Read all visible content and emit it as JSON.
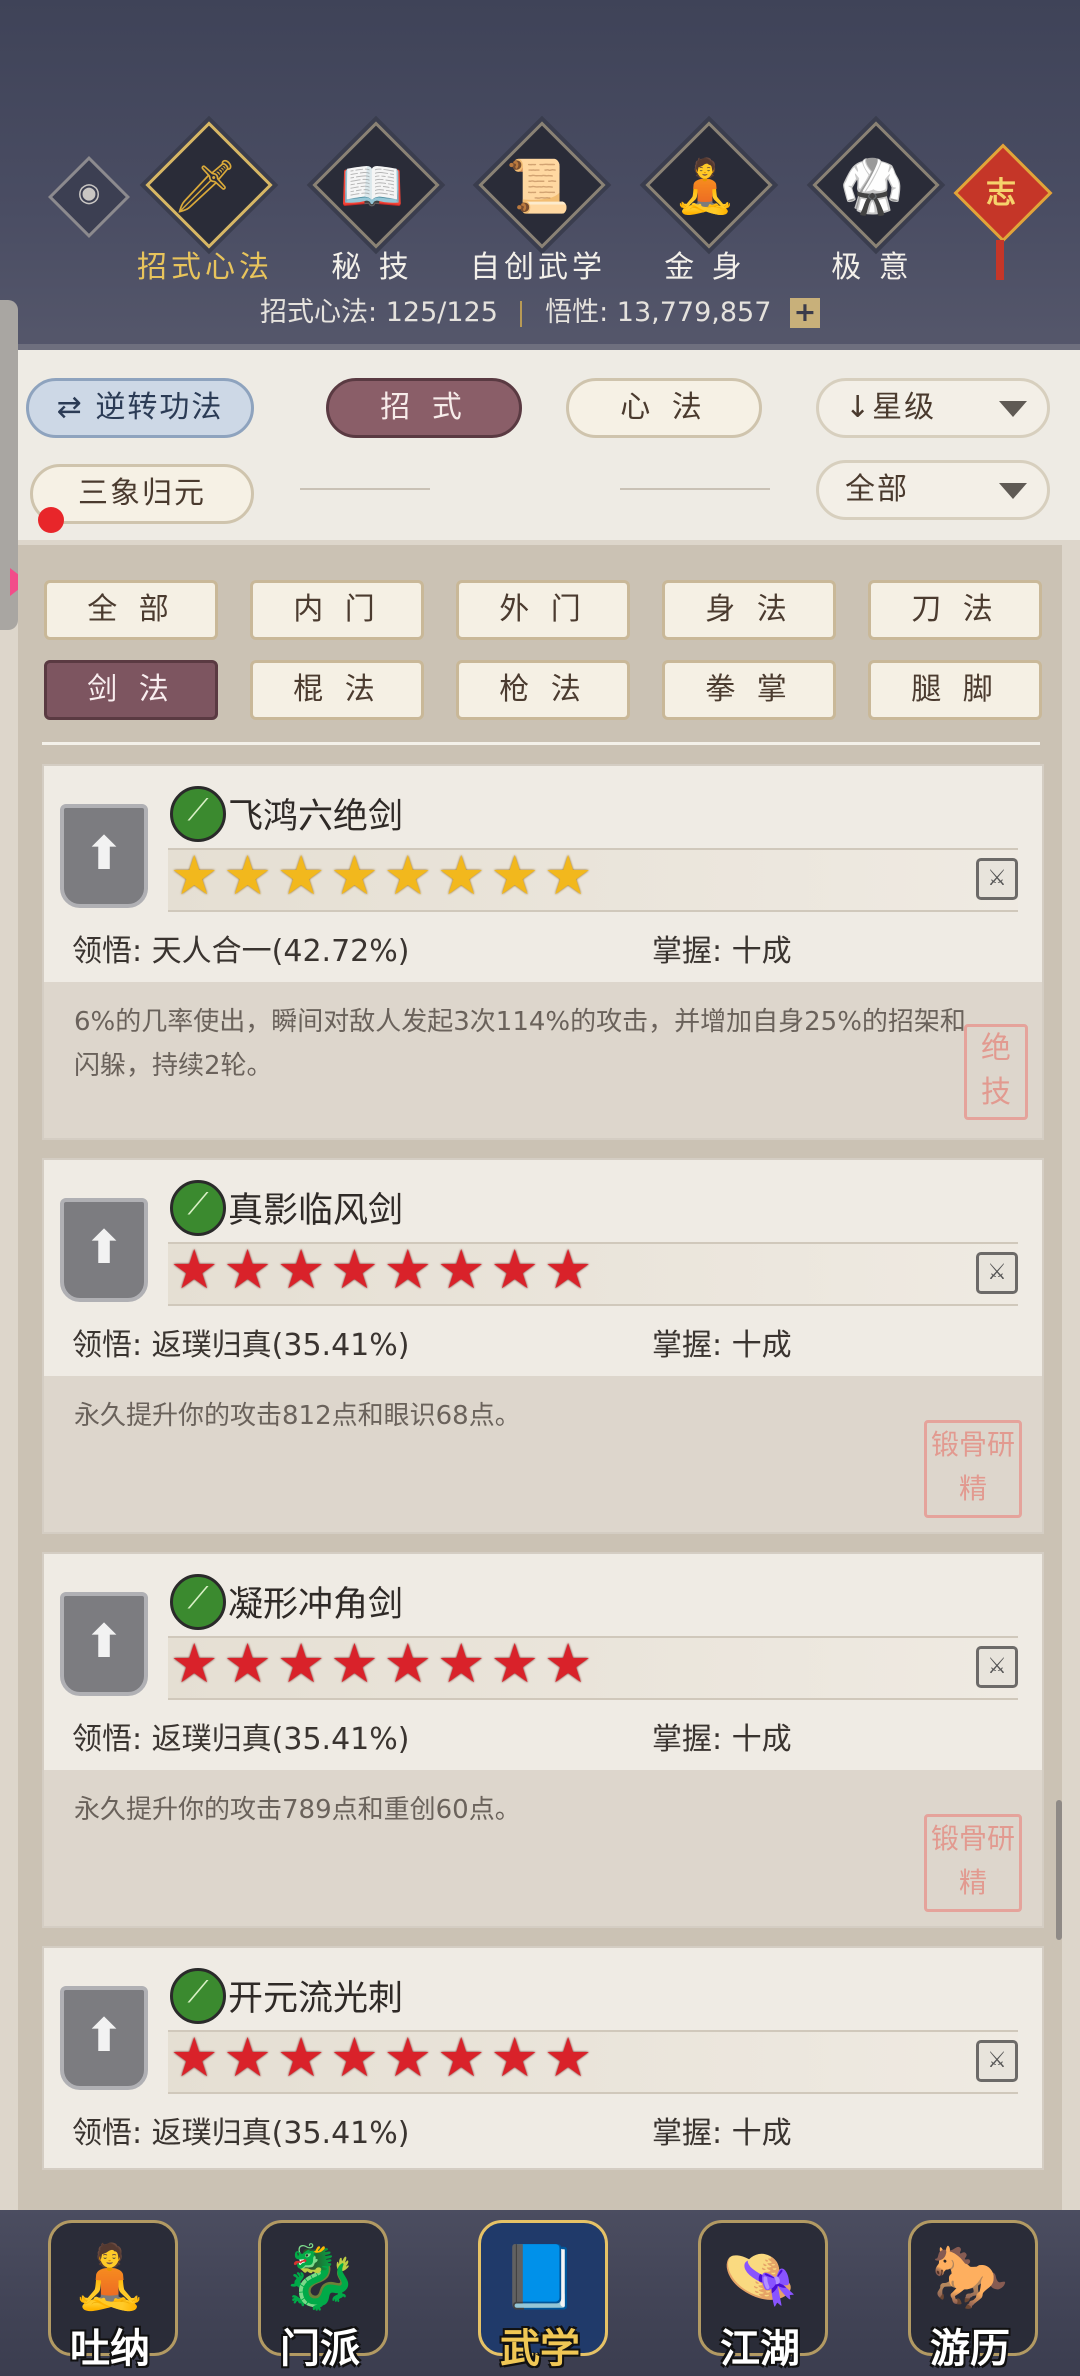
{
  "top_nav": [
    {
      "label": "招式心法",
      "icon": "sword-icon",
      "active": true
    },
    {
      "label": "秘 技",
      "icon": "book-icon",
      "active": false
    },
    {
      "label": "自创武学",
      "icon": "scroll-icon",
      "active": false
    },
    {
      "label": "金 身",
      "icon": "meditation-icon",
      "active": false
    },
    {
      "label": "极 意",
      "icon": "martial-stance-icon",
      "active": false
    }
  ],
  "knot": {
    "char": "志"
  },
  "stats": {
    "moves_label": "招式心法:",
    "moves_value": "125/125",
    "wuxing_label": "悟性:",
    "wuxing_value": "13,779,857",
    "plus": "+"
  },
  "filters": {
    "reverse_label": "逆转功法",
    "reverse_icon": "⇄",
    "tab_moves": "招 式",
    "tab_heart": "心 法",
    "sort_label": "↓星级",
    "sanxiang": "三象归元",
    "all_select": "全部"
  },
  "categories": [
    "全 部",
    "内 门",
    "外 门",
    "身 法",
    "刀 法",
    "剑 法",
    "棍 法",
    "枪 法",
    "拳 掌",
    "腿 脚"
  ],
  "lingwu_label": "领悟:",
  "zhangwo_label": "掌握:",
  "skills": [
    {
      "name": "飞鸿六绝剑",
      "stars": "★★★★★★★★",
      "star_color": "gold",
      "lingwu": "天人合一(42.72%)",
      "zhangwo": "十成",
      "desc": "6%的几率使出，瞬间对敌人发起3次114%的攻击，并增加自身25%的招架和闪躲，持续2轮。",
      "seal": "绝技"
    },
    {
      "name": "真影临风剑",
      "stars": "★★★★★★★★",
      "star_color": "red",
      "lingwu": "返璞归真(35.41%)",
      "zhangwo": "十成",
      "desc": "永久提升你的攻击812点和眼识68点。",
      "seal": "锻骨研精"
    },
    {
      "name": "凝形冲角剑",
      "stars": "★★★★★★★★",
      "star_color": "red",
      "lingwu": "返璞归真(35.41%)",
      "zhangwo": "十成",
      "desc": "永久提升你的攻击789点和重创60点。",
      "seal": "锻骨研精"
    },
    {
      "name": "开元流光刺",
      "stars": "★★★★★★★★",
      "star_color": "red",
      "lingwu": "返璞归真(35.41%)",
      "zhangwo": "十成",
      "desc": "",
      "seal": ""
    }
  ],
  "bottom_nav": [
    {
      "label": "吐纳",
      "icon": "monk-icon",
      "active": false
    },
    {
      "label": "门派",
      "icon": "sect-icon",
      "active": false
    },
    {
      "label": "武学",
      "icon": "martial-book-icon",
      "active": true
    },
    {
      "label": "江湖",
      "icon": "straw-hat-icon",
      "active": false
    },
    {
      "label": "游历",
      "icon": "horse-icon",
      "active": false
    }
  ],
  "colors": {
    "accent_gold": "#e8c45c",
    "active_tab": "#8a5e68",
    "star_gold": "#f2b81d",
    "star_red": "#d9222a"
  }
}
